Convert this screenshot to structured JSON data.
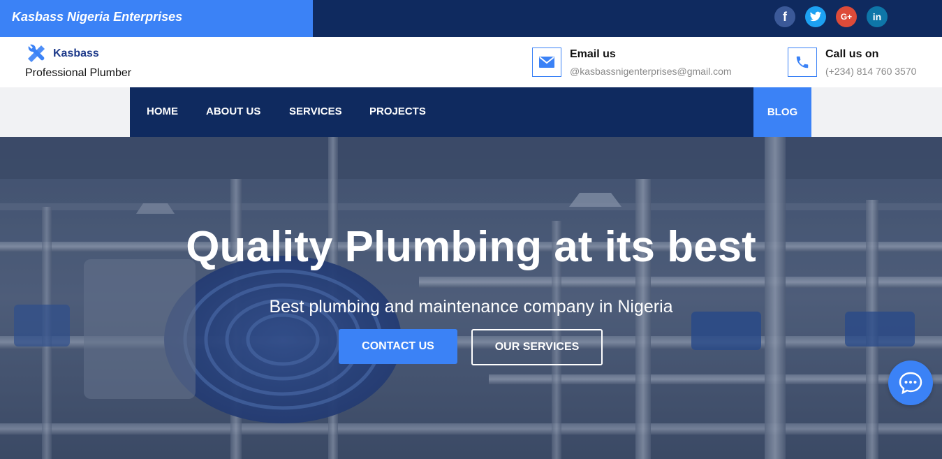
{
  "topbar": {
    "brand": "Kasbass Nigeria Enterprises",
    "social": [
      {
        "icon": "facebook-icon",
        "glyph": "f"
      },
      {
        "icon": "twitter-icon",
        "glyph": "t"
      },
      {
        "icon": "google-plus-icon",
        "glyph": "G+"
      },
      {
        "icon": "linkedin-icon",
        "glyph": "in"
      }
    ]
  },
  "header": {
    "logo_name": "Kasbass",
    "logo_sub": "Professional Plumber",
    "email_title": "Email us",
    "email_value": "@kasbassnigenterprises@gmail.com",
    "phone_title": "Call us on",
    "phone_value": "(+234) 814 760 3570"
  },
  "nav": {
    "items": [
      "HOME",
      "ABOUT US",
      "SERVICES",
      "PROJECTS"
    ],
    "blog": "BLOG"
  },
  "hero": {
    "title": "Quality Plumbing at its best",
    "subtitle": "Best plumbing and maintenance company in Nigeria",
    "contact_button": "CONTACT US",
    "services_button": "OUR SERVICES"
  },
  "colors": {
    "accent": "#3b82f6",
    "navy": "#0f2a5f"
  }
}
